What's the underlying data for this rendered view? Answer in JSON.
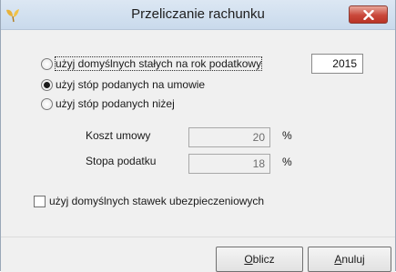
{
  "window": {
    "title": "Przeliczanie rachunku",
    "icon": "app-leaf-icon",
    "close_icon": "close-icon",
    "close_color": "#c9473a"
  },
  "options": {
    "radio_default_rates": {
      "label": "użyj domyślnych stałych na rok podatkowy",
      "checked": false,
      "year_value": "2015"
    },
    "radio_contract_rates": {
      "label": "użyj stóp podanych na umowie",
      "checked": true
    },
    "radio_rates_below": {
      "label": "użyj stóp podanych niżej",
      "checked": false
    }
  },
  "fields": {
    "cost_label": "Koszt umowy",
    "cost_value": "20",
    "cost_unit": "%",
    "tax_label": "Stopa podatku",
    "tax_value": "18",
    "tax_unit": "%"
  },
  "insurance_checkbox": {
    "label": "użyj domyślnych stawek ubezpieczeniowych",
    "checked": false
  },
  "buttons": {
    "calculate": {
      "mnemonic": "O",
      "rest": "blicz"
    },
    "cancel": {
      "mnemonic": "A",
      "rest": "nuluj"
    }
  }
}
